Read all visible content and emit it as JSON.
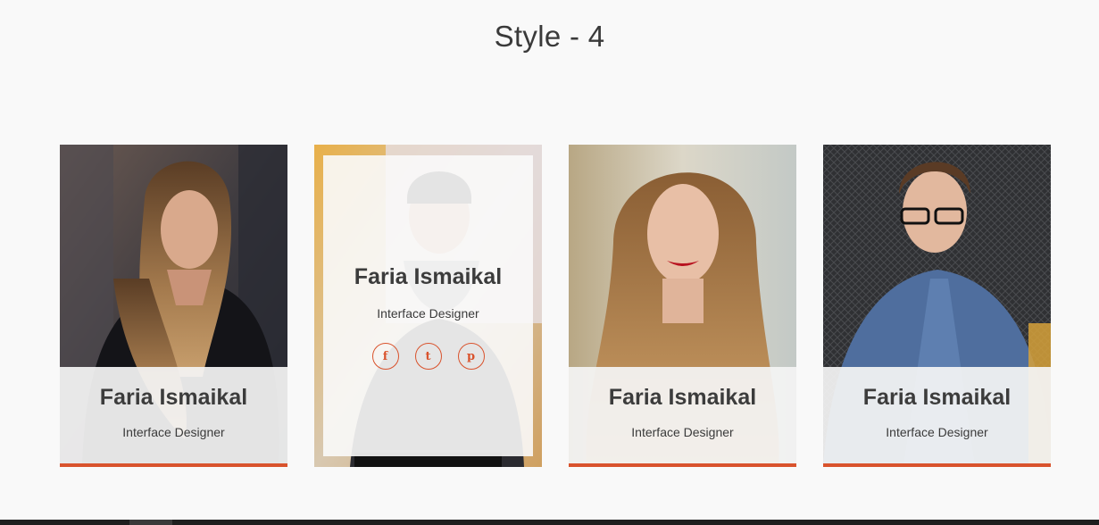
{
  "section": {
    "title": "Style - 4"
  },
  "cards": [
    {
      "name": "Faria Ismaikal",
      "role": "Interface Designer"
    },
    {
      "name": "Faria Ismaikal",
      "role": "Interface Designer",
      "socials": [
        {
          "icon": "facebook-icon",
          "glyph": "f"
        },
        {
          "icon": "twitter-icon",
          "glyph": "t"
        },
        {
          "icon": "pinterest-icon",
          "glyph": "p"
        }
      ]
    },
    {
      "name": "Faria Ismaikal",
      "role": "Interface Designer"
    },
    {
      "name": "Faria Ismaikal",
      "role": "Interface Designer"
    }
  ],
  "colors": {
    "accent": "#d9532d",
    "background": "#f9f9f9",
    "heading": "#3a3a3a"
  }
}
